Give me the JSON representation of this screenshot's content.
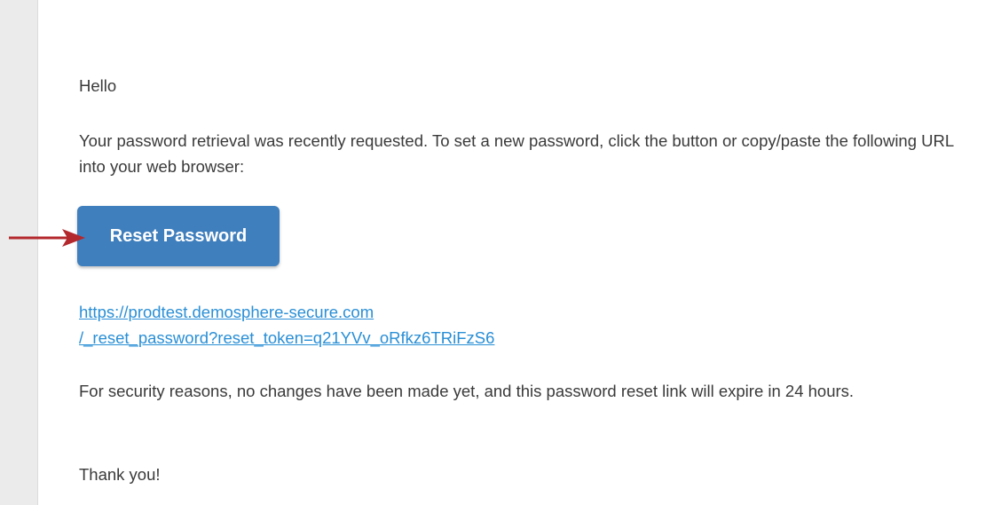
{
  "email": {
    "greeting": "Hello",
    "intro": "Your password retrieval was recently requested. To set a new password, click the button or copy/paste the following URL into your web browser:",
    "button_label": "Reset Password",
    "link_line1": "https://prodtest.demosphere-secure.com",
    "link_line2": "/_reset_password?reset_token=q21YVv_oRfkz6TRiFzS6",
    "security_note": "For security reasons, no changes have been made yet, and this password reset link will expire in 24 hours.",
    "closing": "Thank you!"
  },
  "colors": {
    "button_bg": "#3f7fbd",
    "link": "#2a8fd6",
    "annotation_arrow": "#b3282d"
  },
  "icons": {
    "annotation": "red-arrow-icon"
  }
}
